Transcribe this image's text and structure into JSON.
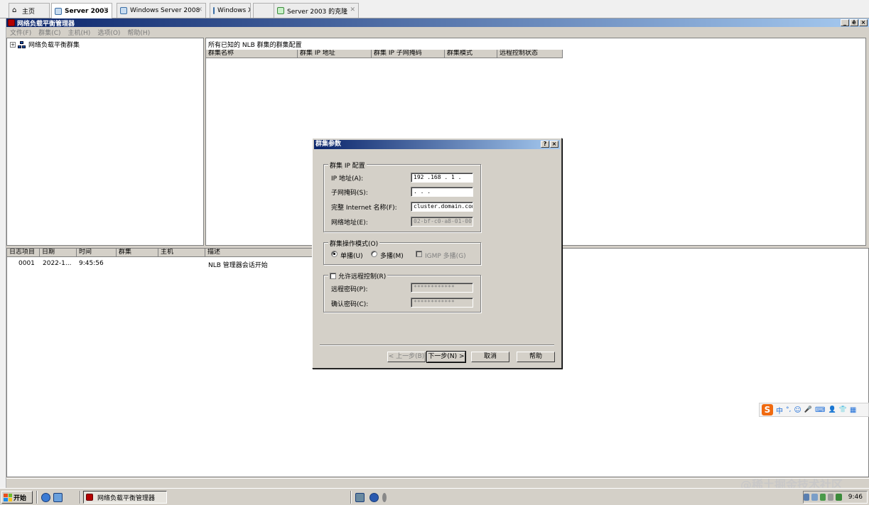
{
  "browser_tabs": [
    {
      "label": "主页",
      "icon": "home-icon"
    },
    {
      "label": "Server 2003",
      "icon": "vm-icon",
      "active": true
    },
    {
      "label": "Windows Server 2008",
      "icon": "vm-icon"
    },
    {
      "label": "Windows XP",
      "icon": "vm-icon"
    },
    {
      "label": "Server 2003 的克隆",
      "icon": "vm-clone-icon"
    }
  ],
  "tab_close_glyph": "✕",
  "mmc": {
    "title": "网络负载平衡管理器",
    "window_buttons": [
      "_",
      "ē",
      "×"
    ],
    "menu": [
      "文件(F)",
      "群集(C)",
      "主机(H)",
      "选项(O)",
      "帮助(H)"
    ]
  },
  "tree": {
    "expand_glyph": "+",
    "root_label": "网络负载平衡群集"
  },
  "cluster_list": {
    "title": "所有已知的 NLB 群集的群集配置",
    "columns": [
      "群集名称",
      "群集 IP 地址",
      "群集 IP 子网掩码",
      "群集模式",
      "远程控制状态"
    ]
  },
  "log": {
    "columns": [
      "日志项目",
      "日期",
      "时间",
      "群集",
      "主机",
      "描述"
    ],
    "rows": [
      {
        "entry": "0001",
        "date": "2022-1...",
        "time": "9:45:56",
        "cluster": "",
        "host": "",
        "description": "NLB 管理器会话开始"
      }
    ]
  },
  "dialog": {
    "title": "群集参数",
    "help_glyph": "?",
    "close_glyph": "×",
    "ip_group": {
      "label": "群集 IP 配置",
      "ip_label": "IP 地址(A):",
      "ip_value": "192 .168 . 1  .  ",
      "subnet_label": "子网掩码(S):",
      "subnet_value": "   .    .    .   ",
      "fqdn_label": "完整 Internet 名称(F):",
      "fqdn_value": "cluster.domain.com",
      "netaddr_label": "网络地址(E):",
      "netaddr_value": "02-bf-c0-a8-01-00"
    },
    "mode_group": {
      "label": "群集操作模式(O)",
      "unicast": "单播(U)",
      "multicast": "多播(M)",
      "igmp": "IGMP 多播(G)",
      "selected": "unicast"
    },
    "remote_group": {
      "checkbox_label": "允许远程控制(R)",
      "password_label": "远程密码(P):",
      "password_value": "************",
      "confirm_label": "确认密码(C):",
      "confirm_value": "************"
    },
    "buttons": {
      "back": "< 上一步(B)",
      "next": "下一步(N) >",
      "cancel": "取消",
      "help": "帮助"
    }
  },
  "ime_bar": {
    "logo": "S",
    "items": [
      "中",
      "°,",
      "☺",
      "🎤",
      "⌨",
      "👤",
      "👕",
      "▦"
    ]
  },
  "taskbar": {
    "start_label": "开始",
    "task_item": "网络负载平衡管理器",
    "time": "9:46"
  },
  "watermark": "@稀土掘金技术社区",
  "colors": {
    "title_bar": "#0a246a",
    "face": "#d4d0c8",
    "ime_accent": "#f06a10"
  }
}
